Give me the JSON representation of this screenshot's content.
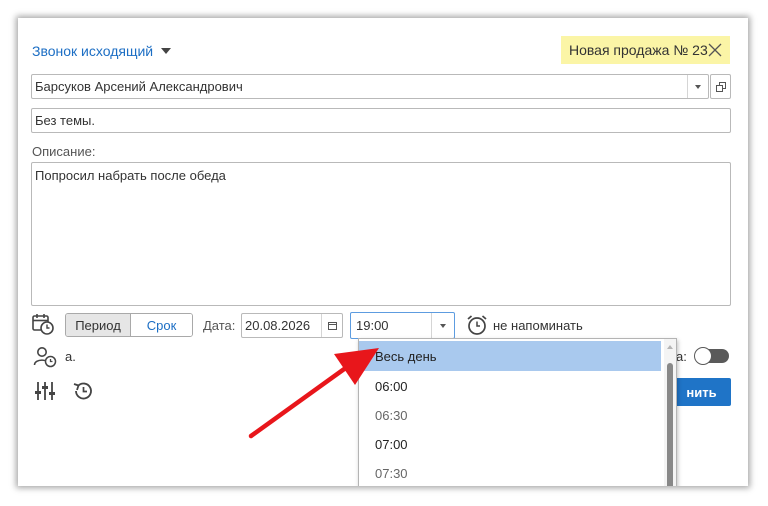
{
  "header": {
    "type_label": "Звонок исходящий",
    "deal_badge": "Новая продажа № 23"
  },
  "contact": {
    "value": "Барсуков Арсений Александрович"
  },
  "subject": {
    "value": "Без темы."
  },
  "description": {
    "label": "Описание:",
    "value": "Попросил набрать после обеда"
  },
  "schedule": {
    "period_label": "Период",
    "deadline_label": "Срок",
    "date_label": "Дата:",
    "date_value": "20.08.2026",
    "time_value": "19:00",
    "reminder_label": "не напоминать"
  },
  "row2": {
    "responsible_text": "а.",
    "toggle_label_tail": "а:",
    "save_button_tail": "нить"
  },
  "time_dropdown": {
    "options": [
      "Весь день",
      "06:00",
      "06:30",
      "07:00",
      "07:30"
    ],
    "selected_index": 0
  },
  "colors": {
    "link_blue": "#1c6ec4",
    "badge_bg": "#fbf5a6",
    "highlight": "#a9c9ee",
    "save_blue": "#1f74c7",
    "arrow_red": "#e8161b"
  }
}
